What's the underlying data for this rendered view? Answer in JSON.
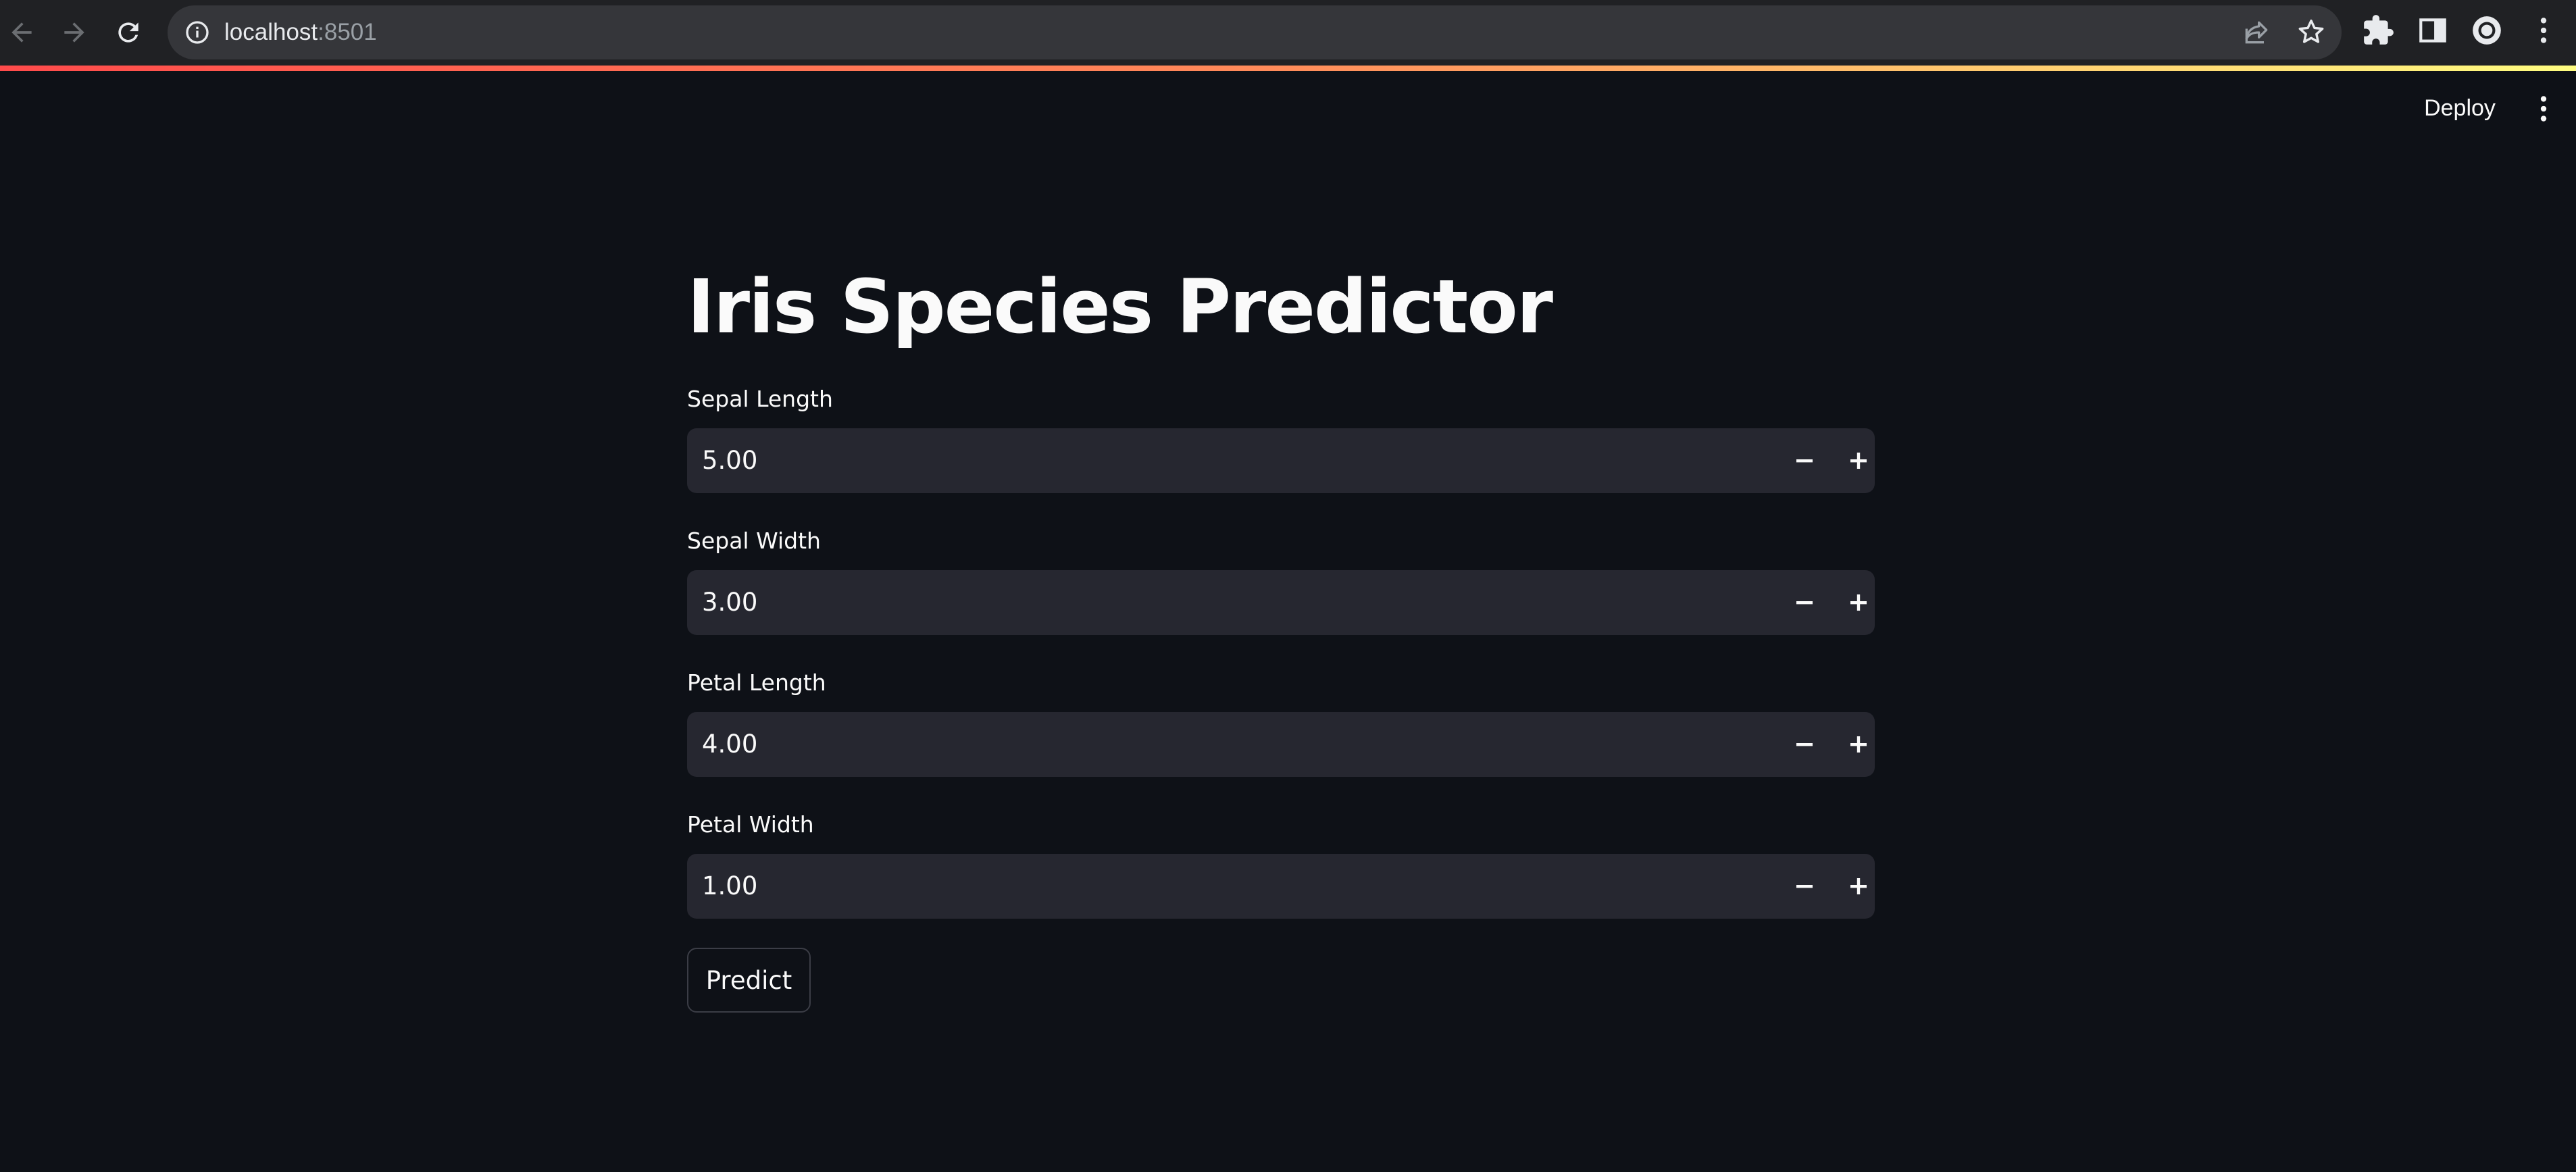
{
  "browser": {
    "url_host": "localhost",
    "url_port": ":8501",
    "icons": {
      "back": "arrow-left-icon",
      "forward": "arrow-right-icon",
      "reload": "reload-icon",
      "info": "info-icon",
      "share": "share-icon",
      "bookmark": "star-icon",
      "extensions": "puzzle-icon",
      "side_panel": "side-panel-icon",
      "profile": "profile-icon",
      "menu": "kebab-menu-icon"
    }
  },
  "header": {
    "deploy_label": "Deploy",
    "menu_icon": "kebab-menu-icon"
  },
  "main": {
    "title": "Iris Species Predictor",
    "inputs": [
      {
        "label": "Sepal Length",
        "value": "5.00"
      },
      {
        "label": "Sepal Width",
        "value": "3.00"
      },
      {
        "label": "Petal Length",
        "value": "4.00"
      },
      {
        "label": "Petal Width",
        "value": "1.00"
      }
    ],
    "predict_label": "Predict"
  },
  "colors": {
    "background": "#0e1117",
    "input_background": "#262730",
    "text": "#fafafa",
    "accent_gradient_start": "#ff4b4b",
    "accent_gradient_end": "#fffd80",
    "browser_bar": "#202124",
    "omnibox": "#35363a"
  }
}
